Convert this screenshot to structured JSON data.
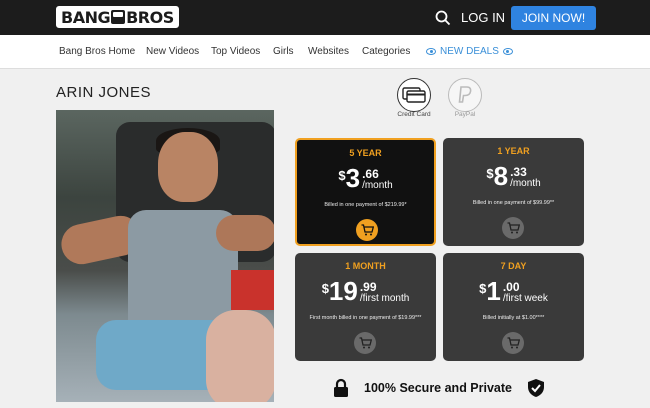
{
  "header": {
    "logo_text_left": "BANG",
    "logo_text_right": "BROS",
    "login_label": "LOG IN",
    "join_label": "JOIN NOW!",
    "search_icon": "search-icon"
  },
  "nav": {
    "items": [
      "Bang Bros Home",
      "New Videos",
      "Top Videos",
      "Girls",
      "Websites",
      "Categories"
    ],
    "deals_label": "NEW DEALS"
  },
  "page": {
    "title": "ARIN JONES"
  },
  "payment": {
    "methods": [
      {
        "label": "Credit Card",
        "icon": "credit-card-icon"
      },
      {
        "label": "PayPal",
        "icon": "paypal-icon"
      }
    ]
  },
  "plans": [
    {
      "name": "5 YEAR",
      "currency": "$",
      "int": "3",
      "dec": ".66",
      "per": "/month",
      "note": "Billed in one payment of $219.99*",
      "selected": true
    },
    {
      "name": "1 YEAR",
      "currency": "$",
      "int": "8",
      "dec": ".33",
      "per": "/month",
      "note": "Billed in one payment of $99.99**",
      "selected": false
    },
    {
      "name": "1 MONTH",
      "currency": "$",
      "int": "19",
      "dec": ".99",
      "per": "/first month",
      "note": "First month billed in one payment of $19.99***",
      "selected": false
    },
    {
      "name": "7 DAY",
      "currency": "$",
      "int": "1",
      "dec": ".00",
      "per": "/first week",
      "note": "Billed initially at $1.00****",
      "selected": false
    }
  ],
  "secure": {
    "label": "100% Secure and Private"
  },
  "colors": {
    "accent": "#f0a020",
    "join": "#2f83e0",
    "deals": "#3a8fd8",
    "card_bg": "#3a3a3a"
  }
}
